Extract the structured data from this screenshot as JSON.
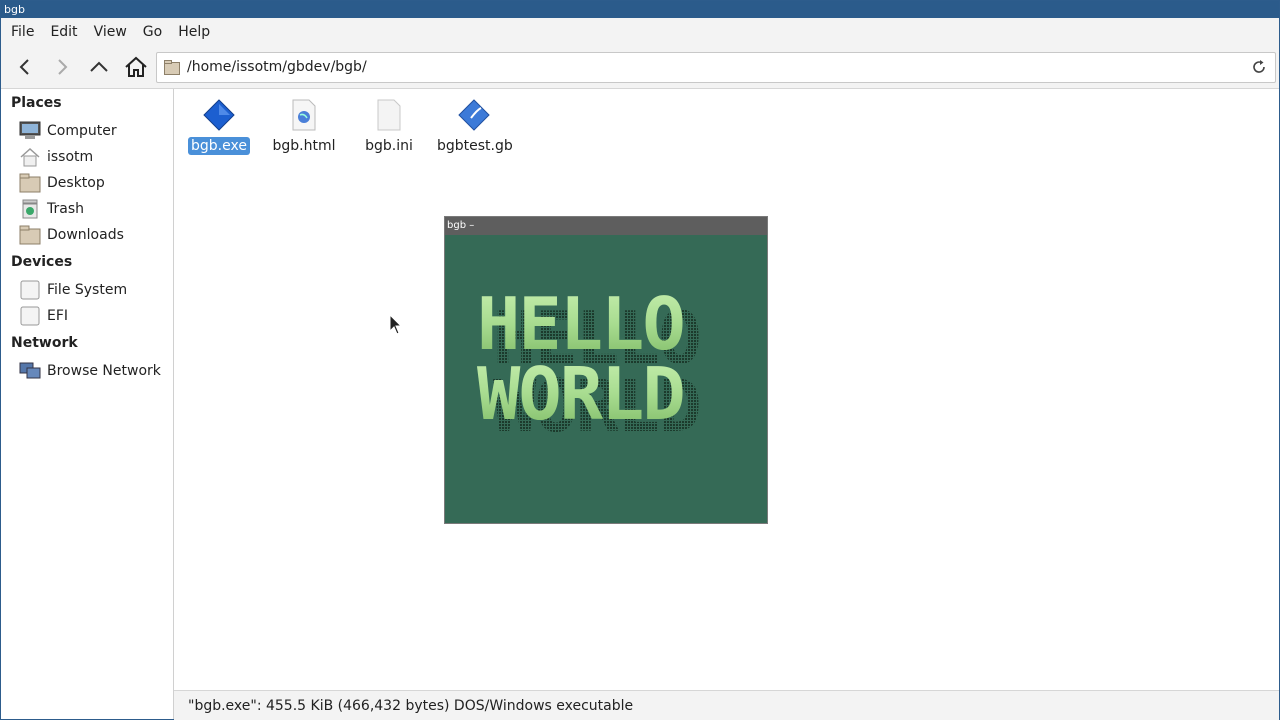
{
  "window": {
    "title": "bgb"
  },
  "menu": [
    "File",
    "Edit",
    "View",
    "Go",
    "Help"
  ],
  "toolbar": {
    "back_icon": "chevron-left-icon",
    "forward_icon": "chevron-right-icon",
    "up_icon": "chevron-up-icon",
    "home_icon": "home-icon",
    "address": "/home/issotm/gbdev/bgb/",
    "reload_icon": "reload-icon"
  },
  "sidebar": {
    "places_title": "Places",
    "places": [
      {
        "label": "Computer",
        "icon": "computer-icon"
      },
      {
        "label": "issotm",
        "icon": "home-folder-icon"
      },
      {
        "label": "Desktop",
        "icon": "desktop-folder-icon"
      },
      {
        "label": "Trash",
        "icon": "trash-icon"
      },
      {
        "label": "Downloads",
        "icon": "downloads-folder-icon"
      }
    ],
    "devices_title": "Devices",
    "devices": [
      {
        "label": "File System",
        "icon": "drive-icon"
      },
      {
        "label": "EFI",
        "icon": "drive-icon"
      }
    ],
    "network_title": "Network",
    "network": [
      {
        "label": "Browse Network",
        "icon": "network-icon"
      }
    ]
  },
  "files": [
    {
      "name": "bgb.exe",
      "icon": "executable-icon",
      "selected": true
    },
    {
      "name": "bgb.html",
      "icon": "html-file-icon",
      "selected": false
    },
    {
      "name": "bgb.ini",
      "icon": "text-file-icon",
      "selected": false
    },
    {
      "name": "bgbtest.gb",
      "icon": "gameboy-rom-icon",
      "selected": false
    }
  ],
  "emulator": {
    "title": "bgb  –",
    "screen_text_line1": "HELLO",
    "screen_text_line2": "WORLD",
    "colors": {
      "bg": "#356a56",
      "text_light": "#c8f0b0",
      "text_mid": "#8cc070",
      "shadow": "#1c3a2c"
    }
  },
  "status": {
    "text": "\"bgb.exe\": 455.5 KiB (466,432 bytes) DOS/Windows executable"
  },
  "colors": {
    "titlebar": "#2b5b8b",
    "selection": "#4a90d9"
  }
}
